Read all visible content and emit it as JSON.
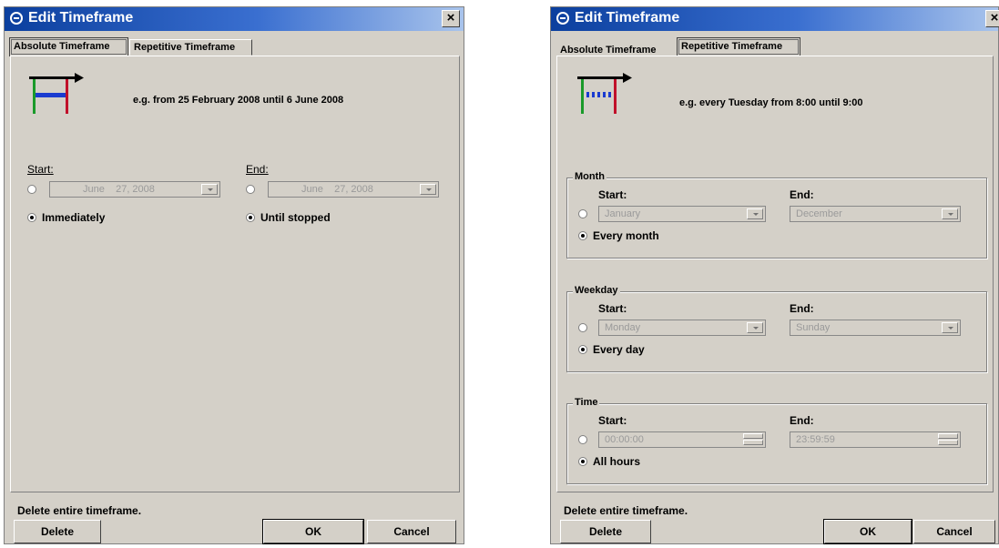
{
  "left": {
    "title": "Edit Timeframe",
    "close_label": "×",
    "tabs": [
      "Absolute Timeframe",
      "Repetitive Timeframe"
    ],
    "example": "e.g. from 25 February 2008 until 6 June 2008",
    "start_label": "Start:",
    "end_label": "End:",
    "start_date": "June    27, 2008",
    "end_date": "June    27, 2008",
    "immediately_label": "Immediately",
    "until_stopped_label": "Until stopped",
    "status": "Delete entire timeframe.",
    "delete_label": "Delete",
    "ok_label": "OK",
    "cancel_label": "Cancel"
  },
  "right": {
    "title": "Edit Timeframe",
    "close_label": "×",
    "tabs": [
      "Absolute Timeframe",
      "Repetitive Timeframe"
    ],
    "example": "e.g. every Tuesday from 8:00 until 9:00",
    "month": {
      "group": "Month",
      "start_label": "Start:",
      "end_label": "End:",
      "start_value": "January",
      "end_value": "December",
      "every_label": "Every month"
    },
    "weekday": {
      "group": "Weekday",
      "start_label": "Start:",
      "end_label": "End:",
      "start_value": "Monday",
      "end_value": "Sunday",
      "every_label": "Every day"
    },
    "time": {
      "group": "Time",
      "start_label": "Start:",
      "end_label": "End:",
      "start_value": "00:00:00",
      "end_value": "23:59:59",
      "every_label": "All hours"
    },
    "status": "Delete entire timeframe.",
    "delete_label": "Delete",
    "ok_label": "OK",
    "cancel_label": "Cancel"
  }
}
